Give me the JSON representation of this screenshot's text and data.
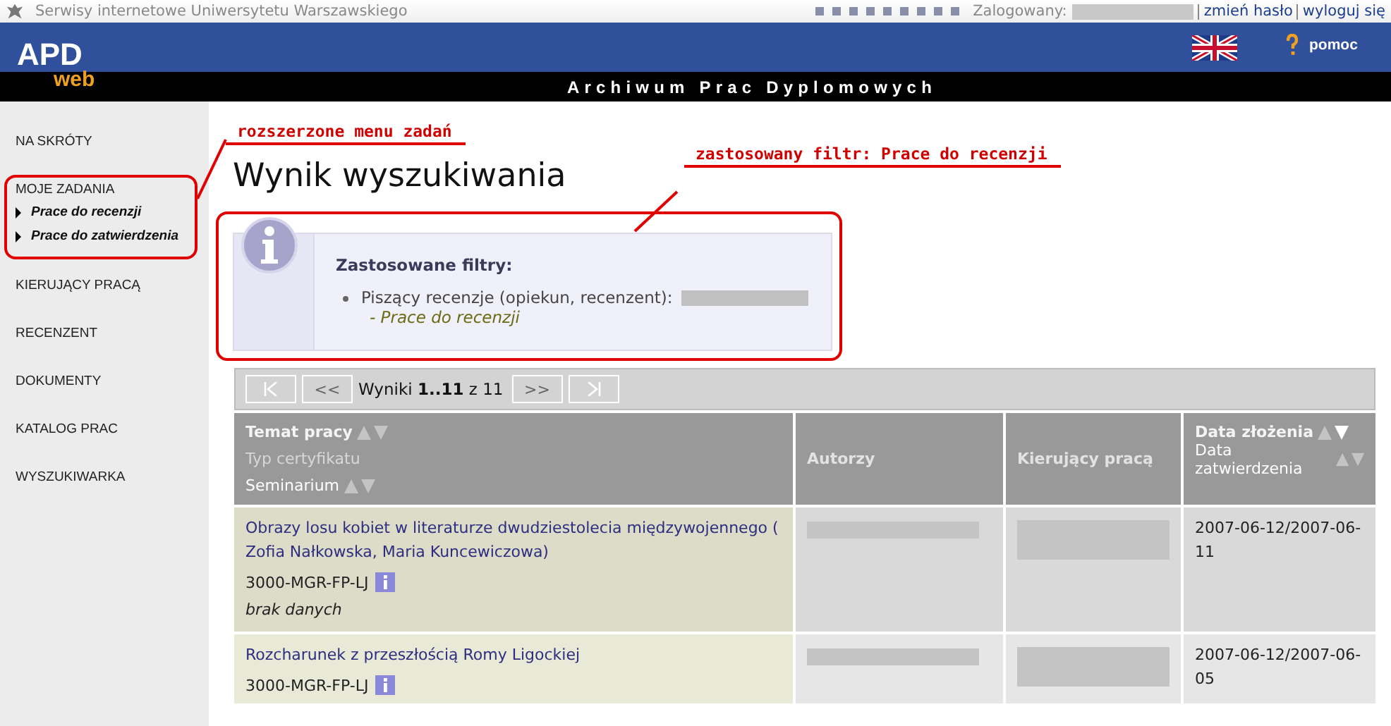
{
  "topbar": {
    "site": "Serwisy internetowe Uniwersytetu Warszawskiego",
    "logged_label": "Zalogowany:",
    "links": [
      "zmień hasło",
      "wyloguj się"
    ]
  },
  "header": {
    "logo_main": "APD",
    "logo_sub": "web",
    "help": "pomoc",
    "title": "Archiwum Prac Dyplomowych"
  },
  "sidebar": {
    "items": [
      {
        "label": "NA SKRÓTY"
      },
      {
        "label": "MOJE ZADANIA",
        "children": [
          {
            "label": "Prace do recenzji"
          },
          {
            "label": "Prace do zatwierdzenia"
          }
        ]
      },
      {
        "label": "KIERUJĄCY PRACĄ"
      },
      {
        "label": "RECENZENT"
      },
      {
        "label": "DOKUMENTY"
      },
      {
        "label": "KATALOG PRAC"
      },
      {
        "label": "WYSZUKIWARKA"
      }
    ]
  },
  "annotations": [
    "rozszerzone menu zadań",
    "zastosowany filtr: Prace do recenzji"
  ],
  "heading": "Wynik wyszukiwania",
  "filters": {
    "title": "Zastosowane filtry:",
    "items": [
      {
        "label": "Piszący recenzje (opiekun, recenzent):",
        "detail": "- Prace do recenzji"
      }
    ]
  },
  "pager": {
    "summary": "Wyniki **1..11** z 11",
    "prev": "<<",
    "next": ">>"
  },
  "table": {
    "columns": [
      {
        "lines": [
          {
            "text": "Temat pracy",
            "kind": "title",
            "sorted": false
          },
          {
            "text": "Typ certyfikatu",
            "kind": "muted"
          },
          {
            "text": "Seminarium",
            "kind": "sub",
            "sorted": false
          }
        ]
      },
      {
        "lines": [
          {
            "text": "Autorzy",
            "kind": "title"
          }
        ]
      },
      {
        "lines": [
          {
            "text": "Kierujący pracą",
            "kind": "title"
          }
        ]
      },
      {
        "lines": [
          {
            "text": "Data złożenia",
            "kind": "title",
            "sorted": true
          },
          {
            "text": "Data zatwierdzenia",
            "kind": "sub",
            "sorted": false
          }
        ]
      }
    ],
    "rows": [
      {
        "title": "Obrazy losu kobiet w literaturze dwudziestolecia międzywojennego ( Zofia Nałkowska, Maria Kuncewiczowa)",
        "code": "3000-MGR-FP-LJ",
        "note": "brak danych",
        "dates": "2007-06-12/2007-06-11"
      },
      {
        "title": "Rozcharunek z przeszłością Romy Ligockiej",
        "code": "3000-MGR-FP-LJ",
        "dates": "2007-06-12/2007-06-05"
      }
    ]
  }
}
